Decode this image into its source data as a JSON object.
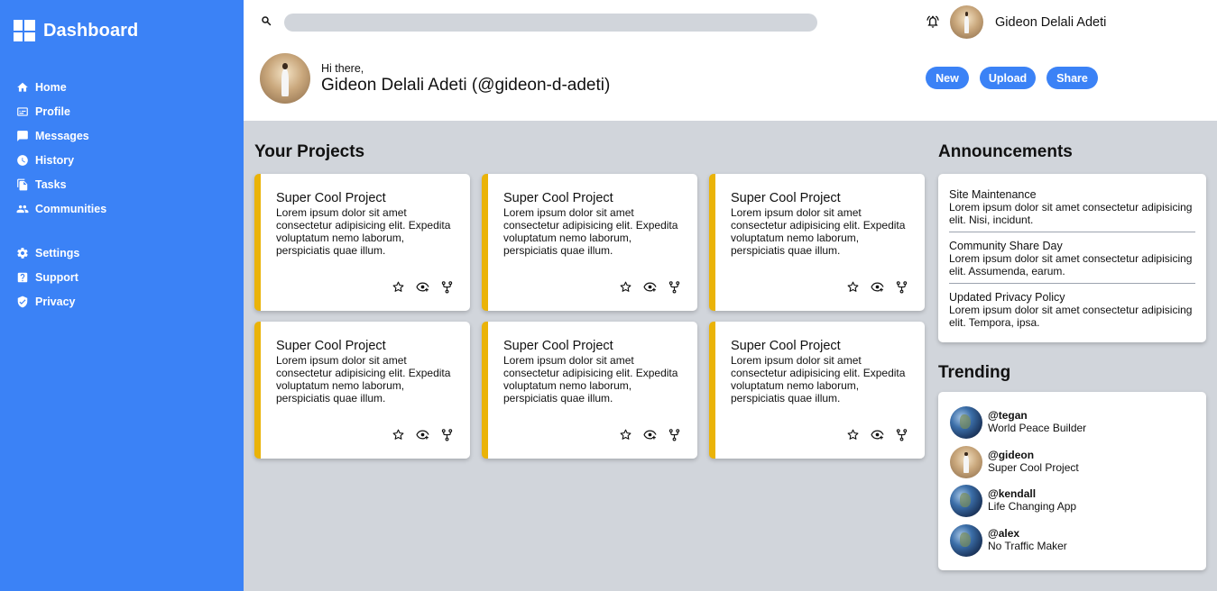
{
  "sidebar": {
    "brand": "Dashboard",
    "nav_primary": [
      {
        "label": "Home",
        "icon": "home-icon"
      },
      {
        "label": "Profile",
        "icon": "profile-card-icon"
      },
      {
        "label": "Messages",
        "icon": "message-icon"
      },
      {
        "label": "History",
        "icon": "clock-icon"
      },
      {
        "label": "Tasks",
        "icon": "document-icon"
      },
      {
        "label": "Communities",
        "icon": "group-icon"
      }
    ],
    "nav_secondary": [
      {
        "label": "Settings",
        "icon": "gear-icon"
      },
      {
        "label": "Support",
        "icon": "help-icon"
      },
      {
        "label": "Privacy",
        "icon": "shield-icon"
      }
    ]
  },
  "header": {
    "search_placeholder": "",
    "user_name": "Gideon Delali Adeti",
    "greeting": "Hi there,",
    "user_handle": "Gideon Delali Adeti (@gideon-d-adeti)",
    "buttons": {
      "new": "New",
      "upload": "Upload",
      "share": "Share"
    }
  },
  "projects": {
    "title": "Your Projects",
    "items": [
      {
        "title": "Super Cool Project",
        "desc": "Lorem ipsum dolor sit amet consectetur adipisicing elit. Expedita voluptatum nemo laborum, perspiciatis quae illum."
      },
      {
        "title": "Super Cool Project",
        "desc": "Lorem ipsum dolor sit amet consectetur adipisicing elit. Expedita voluptatum nemo laborum, perspiciatis quae illum."
      },
      {
        "title": "Super Cool Project",
        "desc": "Lorem ipsum dolor sit amet consectetur adipisicing elit. Expedita voluptatum nemo laborum, perspiciatis quae illum."
      },
      {
        "title": "Super Cool Project",
        "desc": "Lorem ipsum dolor sit amet consectetur adipisicing elit. Expedita voluptatum nemo laborum, perspiciatis quae illum."
      },
      {
        "title": "Super Cool Project",
        "desc": "Lorem ipsum dolor sit amet consectetur adipisicing elit. Expedita voluptatum nemo laborum, perspiciatis quae illum."
      },
      {
        "title": "Super Cool Project",
        "desc": "Lorem ipsum dolor sit amet consectetur adipisicing elit. Expedita voluptatum nemo laborum, perspiciatis quae illum."
      }
    ]
  },
  "announcements": {
    "title": "Announcements",
    "items": [
      {
        "title": "Site Maintenance",
        "body": "Lorem ipsum dolor sit amet consectetur adipisicing elit. Nisi, incidunt."
      },
      {
        "title": "Community Share Day",
        "body": "Lorem ipsum dolor sit amet consectetur adipisicing elit. Assumenda, earum."
      },
      {
        "title": "Updated Privacy Policy",
        "body": "Lorem ipsum dolor sit amet consectetur adipisicing elit. Tempora, ipsa."
      }
    ]
  },
  "trending": {
    "title": "Trending",
    "items": [
      {
        "user": "@tegan",
        "desc": "World Peace Builder",
        "avatar": "globe"
      },
      {
        "user": "@gideon",
        "desc": "Super Cool Project",
        "avatar": "photo"
      },
      {
        "user": "@kendall",
        "desc": "Life Changing App",
        "avatar": "globe"
      },
      {
        "user": "@alex",
        "desc": "No Traffic Maker",
        "avatar": "globe"
      }
    ]
  },
  "colors": {
    "primary": "#3b82f6",
    "card_accent": "#eab308",
    "background": "#d1d5db"
  }
}
